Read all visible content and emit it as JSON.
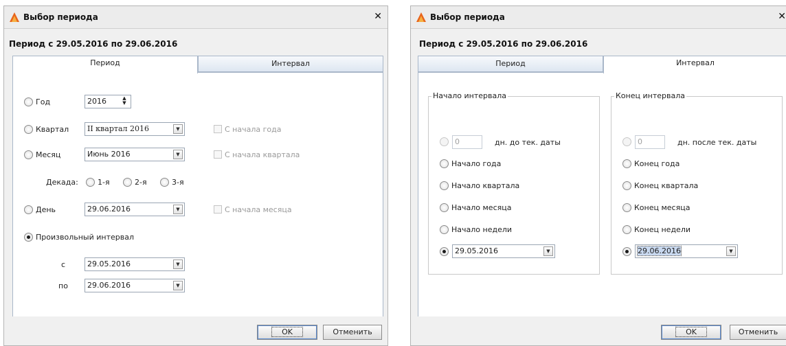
{
  "dialog_left": {
    "title": "Выбор периода",
    "period_text": "Период с 29.05.2016 по 29.06.2016",
    "tabs": [
      {
        "label": "Период",
        "active": true
      },
      {
        "label": "Интервал",
        "active": false
      }
    ],
    "year": {
      "label": "Год",
      "value": "2016"
    },
    "quarter": {
      "label": "Квартал",
      "value": "II квартал 2016",
      "check": "С начала года"
    },
    "month": {
      "label": "Месяц",
      "value": "Июнь 2016",
      "check": "С начала квартала"
    },
    "decade": {
      "label": "Декада:",
      "options": [
        "1-я",
        "2-я",
        "3-я"
      ]
    },
    "day": {
      "label": "День",
      "value": "29.06.2016",
      "check": "С начала месяца"
    },
    "custom": {
      "label": "Произвольный интервал",
      "from_label": "с",
      "from": "29.05.2016",
      "to_label": "по",
      "to": "29.06.2016",
      "selected": true
    },
    "buttons": {
      "ok": "OK",
      "cancel": "Отменить"
    }
  },
  "dialog_right": {
    "title": "Выбор периода",
    "period_text": "Период с 29.05.2016 по 29.06.2016",
    "tabs": [
      {
        "label": "Период",
        "active": false
      },
      {
        "label": "Интервал",
        "active": true
      }
    ],
    "start": {
      "title": "Начало интервала",
      "days_value": "0",
      "days_label": "дн. до тек. даты",
      "options": [
        "Начало года",
        "Начало квартала",
        "Начало месяца",
        "Начало недели"
      ],
      "date": "29.05.2016"
    },
    "end": {
      "title": "Конец интервала",
      "days_value": "0",
      "days_label": "дн. после тек. даты",
      "options": [
        "Конец года",
        "Конец квартала",
        "Конец месяца",
        "Конец недели"
      ],
      "date": "29.06.2016"
    },
    "buttons": {
      "ok": "OK",
      "cancel": "Отменить"
    }
  },
  "colors": {
    "accent": "#e8641b",
    "tab_border": "#a9b7c9"
  },
  "icons": {
    "logo": "app-logo-icon",
    "close": "close-icon",
    "combo": "chevron-down-icon",
    "cursor": "mouse-pointer-icon"
  }
}
